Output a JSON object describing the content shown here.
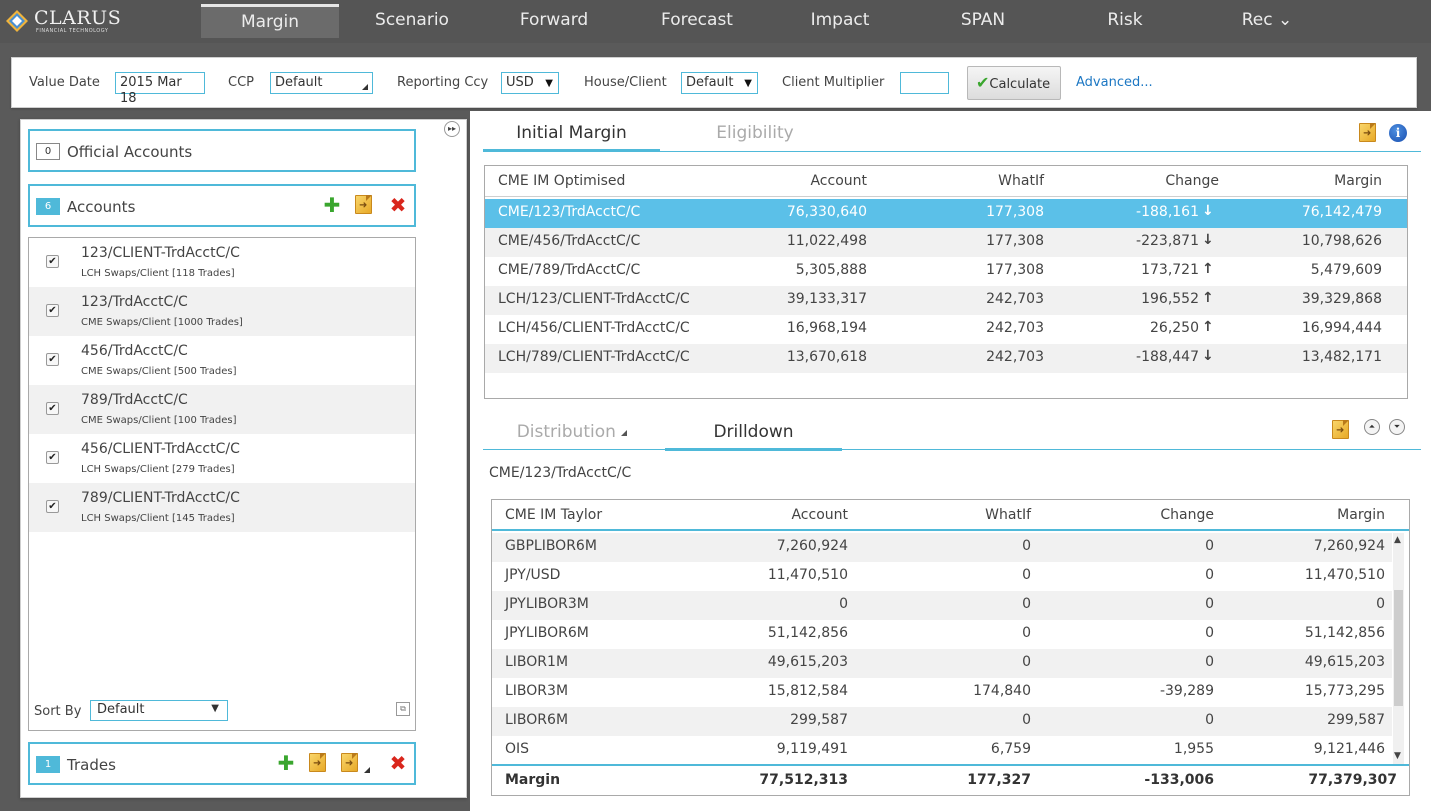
{
  "app": {
    "logo_name": "CLARUS",
    "logo_sub": "FINANCIAL TECHNOLOGY",
    "colors": {
      "accent": "#4fb9d9",
      "selected_row": "#5bc0e8",
      "up": "#ff5a4f",
      "down": "#9ccd2a",
      "nav_bg": "#555555"
    }
  },
  "nav": {
    "tabs": [
      {
        "label": "Margin",
        "active": true
      },
      {
        "label": "Scenario"
      },
      {
        "label": "Forward"
      },
      {
        "label": "Forecast"
      },
      {
        "label": "Impact"
      },
      {
        "label": "SPAN"
      },
      {
        "label": "Risk"
      },
      {
        "label": "Rec",
        "caret": "⌄"
      }
    ]
  },
  "toolbar": {
    "value_date_label": "Value Date",
    "value_date": "2015 Mar 18",
    "ccp_label": "CCP",
    "ccp_value": "Default",
    "reporting_ccy_label": "Reporting Ccy",
    "reporting_ccy_value": "USD",
    "house_client_label": "House/Client",
    "house_client_value": "Default",
    "client_multiplier_label": "Client Multiplier",
    "client_multiplier_value": "",
    "calculate_label": "Calculate",
    "advanced_label": "Advanced..."
  },
  "left": {
    "official": {
      "count": "0",
      "title": "Official Accounts"
    },
    "accounts": {
      "count": "6",
      "title": "Accounts",
      "items": [
        {
          "name": "123/CLIENT-TrdAcctC/C",
          "sub": "LCH Swaps/Client [118 Trades]",
          "checked": true
        },
        {
          "name": "123/TrdAcctC/C",
          "sub": "CME Swaps/Client [1000 Trades]",
          "checked": true
        },
        {
          "name": "456/TrdAcctC/C",
          "sub": "CME Swaps/Client [500 Trades]",
          "checked": true
        },
        {
          "name": "789/TrdAcctC/C",
          "sub": "CME Swaps/Client [100 Trades]",
          "checked": true
        },
        {
          "name": "456/CLIENT-TrdAcctC/C",
          "sub": "LCH Swaps/Client [279 Trades]",
          "checked": true
        },
        {
          "name": "789/CLIENT-TrdAcctC/C",
          "sub": "LCH Swaps/Client [145 Trades]",
          "checked": true
        }
      ]
    },
    "sort_by_label": "Sort By",
    "sort_by_value": "Default",
    "trades": {
      "count": "1",
      "title": "Trades"
    }
  },
  "initial_margin": {
    "tabs": [
      {
        "label": "Initial Margin",
        "active": true
      },
      {
        "label": "Eligibility"
      }
    ],
    "columns": [
      "CME IM Optimised",
      "Account",
      "WhatIf",
      "Change",
      "Margin"
    ],
    "rows": [
      {
        "name": "CME/123/TrdAcctC/C",
        "account": "76,330,640",
        "whatif": "177,308",
        "change": "-188,161",
        "dir": "down",
        "margin": "76,142,479",
        "selected": true
      },
      {
        "name": "CME/456/TrdAcctC/C",
        "account": "11,022,498",
        "whatif": "177,308",
        "change": "-223,871",
        "dir": "down",
        "margin": "10,798,626"
      },
      {
        "name": "CME/789/TrdAcctC/C",
        "account": "5,305,888",
        "whatif": "177,308",
        "change": "173,721",
        "dir": "up",
        "margin": "5,479,609"
      },
      {
        "name": "LCH/123/CLIENT-TrdAcctC/C",
        "account": "39,133,317",
        "whatif": "242,703",
        "change": "196,552",
        "dir": "up",
        "margin": "39,329,868"
      },
      {
        "name": "LCH/456/CLIENT-TrdAcctC/C",
        "account": "16,968,194",
        "whatif": "242,703",
        "change": "26,250",
        "dir": "up",
        "margin": "16,994,444"
      },
      {
        "name": "LCH/789/CLIENT-TrdAcctC/C",
        "account": "13,670,618",
        "whatif": "242,703",
        "change": "-188,447",
        "dir": "down",
        "margin": "13,482,171"
      }
    ]
  },
  "drilldown": {
    "tabs": [
      {
        "label": "Distribution",
        "active": false
      },
      {
        "label": "Drilldown",
        "active": true
      }
    ],
    "path": "CME/123/TrdAcctC/C",
    "columns": [
      "CME IM Taylor",
      "Account",
      "WhatIf",
      "Change",
      "Margin"
    ],
    "rows": [
      {
        "name": "GBPLIBOR6M",
        "account": "7,260,924",
        "whatif": "0",
        "change": "0",
        "margin": "7,260,924"
      },
      {
        "name": "JPY/USD",
        "account": "11,470,510",
        "whatif": "0",
        "change": "0",
        "margin": "11,470,510"
      },
      {
        "name": "JPYLIBOR3M",
        "account": "0",
        "whatif": "0",
        "change": "0",
        "margin": "0"
      },
      {
        "name": "JPYLIBOR6M",
        "account": "51,142,856",
        "whatif": "0",
        "change": "0",
        "margin": "51,142,856"
      },
      {
        "name": "LIBOR1M",
        "account": "49,615,203",
        "whatif": "0",
        "change": "0",
        "margin": "49,615,203"
      },
      {
        "name": "LIBOR3M",
        "account": "15,812,584",
        "whatif": "174,840",
        "change": "-39,289",
        "margin": "15,773,295"
      },
      {
        "name": "LIBOR6M",
        "account": "299,587",
        "whatif": "0",
        "change": "0",
        "margin": "299,587"
      },
      {
        "name": "OIS",
        "account": "9,119,491",
        "whatif": "6,759",
        "change": "1,955",
        "margin": "9,121,446"
      }
    ],
    "total": {
      "name": "Margin",
      "account": "77,512,313",
      "whatif": "177,327",
      "change": "-133,006",
      "margin": "77,379,307"
    }
  }
}
